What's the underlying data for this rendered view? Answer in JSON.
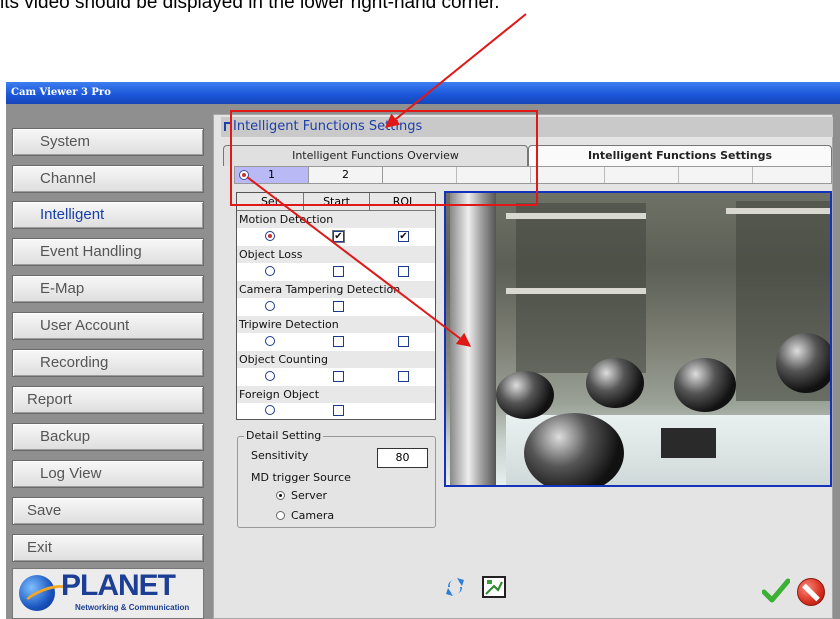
{
  "caption": "its video should be displayed in the lower right-hand corner.",
  "window": {
    "title": "Cam Viewer 3 Pro"
  },
  "nav": {
    "items": [
      {
        "label": "System"
      },
      {
        "label": "Channel"
      },
      {
        "label": "Intelligent",
        "active": true
      },
      {
        "label": "Event Handling"
      },
      {
        "label": "E-Map"
      },
      {
        "label": "User Account"
      },
      {
        "label": "Recording"
      },
      {
        "label": "Report"
      },
      {
        "label": "Backup"
      },
      {
        "label": "Log View"
      },
      {
        "label": "Save"
      },
      {
        "label": "Exit"
      }
    ]
  },
  "logo": {
    "brand": "PLANET",
    "tagline": "Networking & Communication"
  },
  "panel": {
    "title": "Intelligent Functions Settings"
  },
  "tabs": [
    {
      "label": "Intelligent Functions Overview"
    },
    {
      "label": "Intelligent Functions Settings",
      "selected": true
    }
  ],
  "channels": [
    {
      "label": "1",
      "selected": true
    },
    {
      "label": "2"
    }
  ],
  "functions": {
    "headers": [
      "Set",
      "Start",
      "ROI"
    ],
    "rows": [
      {
        "label": "Motion Detection",
        "set": true,
        "start": true,
        "roi": true,
        "has_roi": true
      },
      {
        "label": "Object Loss",
        "set": false,
        "start": false,
        "roi": false,
        "has_roi": true
      },
      {
        "label": "Camera Tampering Detection",
        "set": false,
        "start": false,
        "has_roi": false
      },
      {
        "label": "Tripwire Detection",
        "set": false,
        "start": false,
        "roi": false,
        "has_roi": true
      },
      {
        "label": "Object Counting",
        "set": false,
        "start": false,
        "roi": false,
        "has_roi": true
      },
      {
        "label": "Foreign Object",
        "set": false,
        "start": false,
        "has_roi": false
      }
    ]
  },
  "detail": {
    "legend": "Detail Setting",
    "sensitivity_label": "Sensitivity",
    "sensitivity_value": "80",
    "trigger_label": "MD trigger Source",
    "trigger_options": [
      {
        "label": "Server",
        "selected": true
      },
      {
        "label": "Camera",
        "selected": false
      }
    ]
  },
  "icons": {
    "refresh": "refresh-icon",
    "snapshot": "snapshot-icon",
    "confirm": "check-icon",
    "cancel": "cancel-icon"
  },
  "colors": {
    "title_bar": "#1a55d8",
    "accent_text": "#1c3fa8",
    "annotation": "#e01818",
    "video_border": "#1533b8",
    "selected_channel": "#b9b9f5"
  }
}
